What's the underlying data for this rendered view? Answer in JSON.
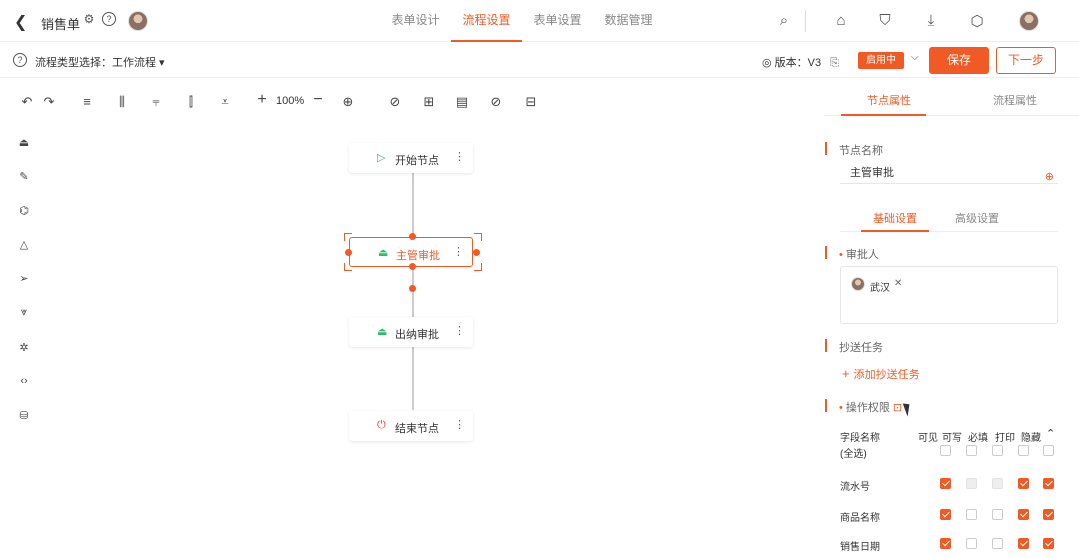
{
  "header": {
    "title": "销售单",
    "tabs": [
      {
        "label": "表单设计",
        "active": false
      },
      {
        "label": "流程设置",
        "active": true
      },
      {
        "label": "表单设置",
        "active": false
      },
      {
        "label": "数据管理",
        "active": false
      }
    ]
  },
  "subbar": {
    "flow_type_label": "流程类型选择：工作流程",
    "version_label": "版本：V3",
    "status_badge": "启用中",
    "save_label": "保存",
    "publish_label": "下一步"
  },
  "toolbar": {
    "zoom": "100%"
  },
  "flow": {
    "nodes": [
      {
        "label": "开始节点",
        "icon": "play-circle-icon",
        "color": "#2ebd6b",
        "selected": false
      },
      {
        "label": "主管审批",
        "icon": "stamp-icon",
        "color": "#2ebd6b",
        "selected": true
      },
      {
        "label": "出纳审批",
        "icon": "stamp-icon",
        "color": "#2ebd6b",
        "selected": false
      },
      {
        "label": "结束节点",
        "icon": "power-icon",
        "color": "#e03c31",
        "selected": false
      }
    ]
  },
  "panel": {
    "tabs": [
      {
        "label": "节点属性",
        "active": true
      },
      {
        "label": "流程属性",
        "active": false
      }
    ],
    "node_name_label": "节点名称",
    "node_name_value": "主管审批",
    "sub_tabs": [
      {
        "label": "基础设置",
        "active": true
      },
      {
        "label": "高级设置",
        "active": false
      }
    ],
    "approver_label": "审批人",
    "approver_name": "武汉",
    "cc_label": "抄送任务",
    "add_cc_label": "添加抄送任务",
    "perm_label": "操作权限",
    "perm_columns": [
      "字段名称",
      "可见",
      "可写",
      "必填",
      "打印",
      "隐藏"
    ],
    "perm_rows": [
      {
        "name": "(全选)",
        "checks": [
          "off",
          "off",
          "off",
          "off",
          "off"
        ]
      },
      {
        "name": "流水号",
        "checks": [
          "on",
          "dis",
          "dis",
          "on",
          "on"
        ]
      },
      {
        "name": "商品名称",
        "checks": [
          "on",
          "off",
          "off",
          "on",
          "on"
        ]
      },
      {
        "name": "销售日期",
        "checks": [
          "on",
          "off",
          "off",
          "on",
          "on"
        ]
      }
    ]
  },
  "colors": {
    "accent": "#f15a24",
    "green": "#2ebd6b",
    "red": "#e03c31"
  }
}
